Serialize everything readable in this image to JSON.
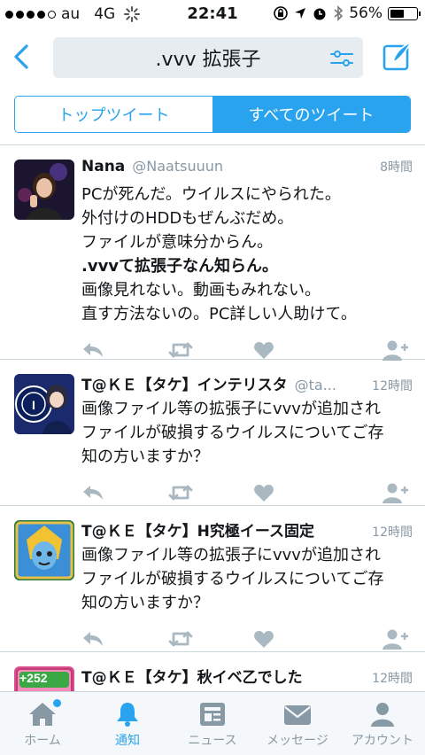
{
  "status_bar": {
    "carrier": "au",
    "network": "4G",
    "time": "22:41",
    "battery": "56%",
    "battery_level": 0.56
  },
  "header": {
    "search_query": ".vvv 拡張子"
  },
  "segments": {
    "top": "トップツイート",
    "all": "すべてのツイート",
    "active": "all"
  },
  "tweets": [
    {
      "name": "Nana",
      "handle": "@Naatsuuun",
      "time": "8時間",
      "lines": [
        "PCが死んだ。ウイルスにやられた。",
        "外付けのHDDもぜんぶだめ。",
        "ファイルが意味分からん。",
        ".vvvて拡張子なん知らん。",
        "画像見れない。動画もみれない。",
        "直す方法ないの。PC詳しい人助けて。"
      ]
    },
    {
      "name": "T@ＫＥ【タケ】インテリスタ",
      "handle": "@ta...",
      "time": "12時間",
      "lines": [
        "画像ファイル等の拡張子にvvvが追加され",
        "ファイルが破損するウイルスについてご存",
        "知の方いますか？"
      ]
    },
    {
      "name": "T@ＫＥ【タケ】H究極イース固定",
      "handle": "",
      "time": "12時間",
      "lines": [
        "画像ファイル等の拡張子にvvvが追加され",
        "ファイルが破損するウイルスについてご存",
        "知の方いますか？"
      ]
    },
    {
      "name": "T@ＫＥ【タケ】秋イベ乙でした",
      "handle": "",
      "time": "12時間",
      "badge": "+252",
      "lines": []
    }
  ],
  "tabbar": {
    "home": "ホーム",
    "notifications": "通知",
    "news": "ニュース",
    "messages": "メッセージ",
    "account": "アカウント",
    "active": "notifications"
  },
  "colors": {
    "accent": "#2aa3ef",
    "icon_gray": "#aab8c2",
    "text_gray": "#8899a6"
  }
}
